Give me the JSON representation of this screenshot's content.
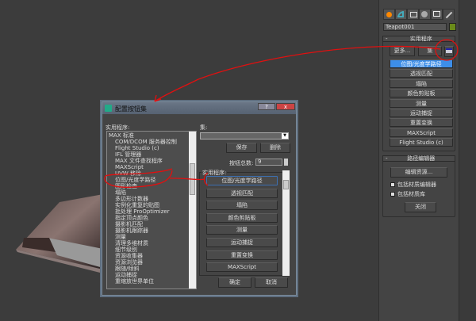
{
  "command_panel": {
    "tabs": [
      "create-icon",
      "modify-icon",
      "hierarchy-icon",
      "motion-icon",
      "display-icon",
      "utilities-icon"
    ],
    "object_name": "Teapot001",
    "object_color": "#6a8a1a",
    "utilities_rollout": {
      "title": "实用程序",
      "more_label": "更多...",
      "sets_label": "集",
      "configure_icon": "configure-button-sets-icon",
      "buttons": [
        "位图/光度学路径",
        "透视匹配",
        "塌陷",
        "颜色剪贴板",
        "测量",
        "运动捕捉",
        "重置变换",
        "MAXScript",
        "Flight Studio (c)"
      ],
      "active_index": 0
    },
    "path_editor_rollout": {
      "title": "路径编辑器",
      "edit_resources_label": "编辑资源...",
      "include_material_editor": "包括材质编辑器",
      "include_material_library": "包括材质库",
      "include_material_editor_checked": true,
      "include_material_library_checked": true,
      "close_label": "关闭"
    }
  },
  "dialog": {
    "title": "配置按钮集",
    "help_label": "?",
    "close_label": "x",
    "utilities_label": "实用程序:",
    "utilities_list": [
      "MAX 标准",
      "COM/DCOM 服务器控制",
      "Flight Studio (c)",
      "IFL 管理器",
      "MAX 文件查找程序",
      "MAXScript",
      "UVW 移除",
      "位图/光度学路径",
      "图形检查",
      "塌陷",
      "多边形计数器",
      "实例化重复的贴图",
      "批处理 ProOptimizer",
      "指定顶点颜色",
      "摄影机匹配",
      "摄影机跟踪器",
      "测量",
      "清理多维材质",
      "细节级别",
      "资源收集器",
      "资源浏览器",
      "跟随/倾斜",
      "运动捕捉",
      "重缩放世界单位"
    ],
    "sets_label": "集:",
    "sets_value": "",
    "save_label": "保存",
    "delete_label": "删除",
    "total_buttons_label": "按钮总数:",
    "total_buttons_value": "9",
    "buttons_group_label": "实用程序:",
    "buttons": [
      "位图/光度学路径",
      "透视匹配",
      "塌陷",
      "颜色剪贴板",
      "测量",
      "运动捕捉",
      "重置变换",
      "MAXScript"
    ],
    "ok_label": "确定",
    "cancel_label": "取消"
  },
  "colors": {
    "viewport": "#3c3c3c",
    "highlight": "#3d8ee8",
    "annotation": "#e01010"
  }
}
